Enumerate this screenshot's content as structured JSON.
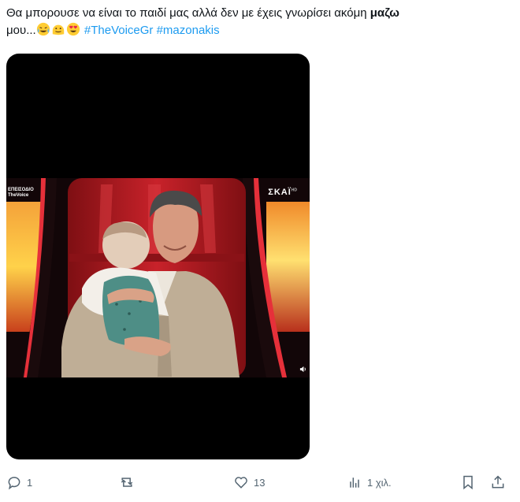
{
  "tweet": {
    "text_line1": "Θα μπορουσε να είναι το παιδί μας αλλά δεν με έχεις γνωρίσει ακόμη ",
    "bold_word": "μαζω",
    "text_line2": "μου...",
    "hashtags": [
      "#TheVoiceGr",
      "#mazonakis"
    ],
    "emojis": [
      "face-with-tears-of-joy-icon",
      "melting-face-icon",
      "heart-eyes-icon"
    ]
  },
  "video": {
    "channel_logo_left": [
      "ΕΠΕΙΣΟΔΙΟ",
      "TheVoice"
    ],
    "channel_logo_right": "ΣΚΑΪ",
    "channel_logo_right_sup": "HD"
  },
  "actions": {
    "reply_count": "1",
    "like_count": "13",
    "views_count": "1 χιλ."
  },
  "colors": {
    "accent": "#1d9bf0",
    "muted": "#536471",
    "text": "#0f1419"
  }
}
